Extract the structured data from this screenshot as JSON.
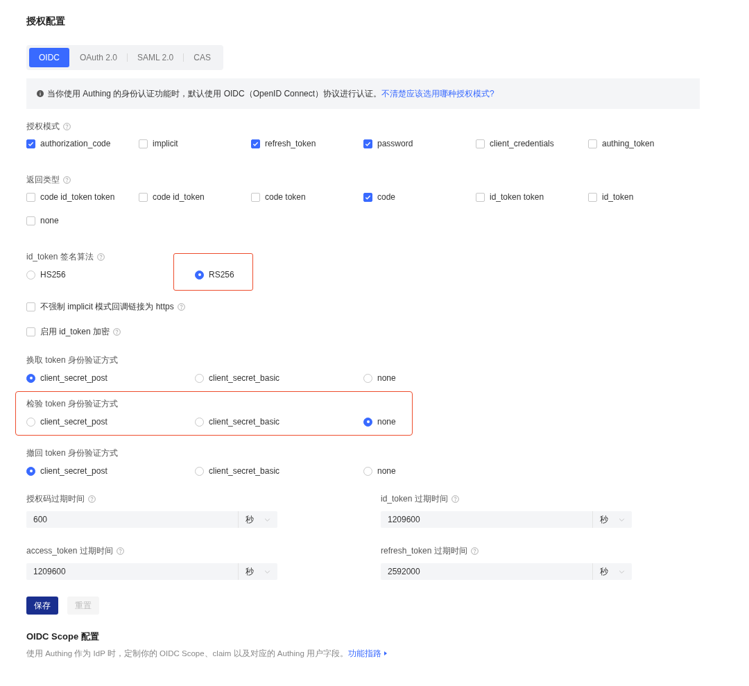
{
  "title": "授权配置",
  "tabs": [
    {
      "label": "OIDC",
      "selected": true
    },
    {
      "label": "OAuth 2.0",
      "selected": false
    },
    {
      "label": "SAML 2.0",
      "selected": false
    },
    {
      "label": "CAS",
      "selected": false
    }
  ],
  "notice": {
    "text": "当你使用 Authing 的身份认证功能时，默认使用 OIDC（OpenID Connect）协议进行认证。",
    "link": "不清楚应该选用哪种授权模式?"
  },
  "sections": [
    {
      "kind": "checkboxes",
      "label": "授权模式",
      "help": true,
      "highlighted": false,
      "options": [
        {
          "label": "authorization_code",
          "checked": true
        },
        {
          "label": "implicit",
          "checked": false
        },
        {
          "label": "refresh_token",
          "checked": true
        },
        {
          "label": "password",
          "checked": true
        },
        {
          "label": "client_credentials",
          "checked": false
        },
        {
          "label": "authing_token",
          "checked": false
        }
      ]
    },
    {
      "kind": "checkboxes",
      "label": "返回类型",
      "help": true,
      "highlighted": false,
      "options": [
        {
          "label": "code id_token token",
          "checked": false
        },
        {
          "label": "code id_token",
          "checked": false
        },
        {
          "label": "code token",
          "checked": false
        },
        {
          "label": "code",
          "checked": true
        },
        {
          "label": "id_token token",
          "checked": false
        },
        {
          "label": "id_token",
          "checked": false
        },
        {
          "label": "none",
          "checked": false
        }
      ]
    },
    {
      "kind": "radios",
      "label": "id_token 签名算法",
      "help": true,
      "highlighted": false,
      "options": [
        {
          "label": "HS256",
          "selected": false,
          "highlighted": false
        },
        {
          "label": "RS256",
          "selected": true,
          "highlighted": true
        }
      ]
    },
    {
      "kind": "toggle",
      "label": "不强制 implicit 模式回调链接为 https",
      "help": true,
      "checked": false
    },
    {
      "kind": "toggle",
      "label": "启用 id_token 加密",
      "help": true,
      "checked": false
    },
    {
      "kind": "radios",
      "label": "换取 token 身份验证方式",
      "help": false,
      "highlighted": false,
      "options": [
        {
          "label": "client_secret_post",
          "selected": true,
          "highlighted": false
        },
        {
          "label": "client_secret_basic",
          "selected": false,
          "highlighted": false
        },
        {
          "label": "none",
          "selected": false,
          "highlighted": false
        }
      ]
    },
    {
      "kind": "radios",
      "label": "检验 token 身份验证方式",
      "help": false,
      "highlighted": true,
      "options": [
        {
          "label": "client_secret_post",
          "selected": false,
          "highlighted": false
        },
        {
          "label": "client_secret_basic",
          "selected": false,
          "highlighted": false
        },
        {
          "label": "none",
          "selected": true,
          "highlighted": false
        }
      ]
    },
    {
      "kind": "radios",
      "label": "撤回 token 身份验证方式",
      "help": false,
      "highlighted": false,
      "options": [
        {
          "label": "client_secret_post",
          "selected": true,
          "highlighted": false
        },
        {
          "label": "client_secret_basic",
          "selected": false,
          "highlighted": false
        },
        {
          "label": "none",
          "selected": false,
          "highlighted": false
        }
      ]
    }
  ],
  "expiry_fields": [
    {
      "label": "授权码过期时间",
      "value": "600",
      "unit": "秒"
    },
    {
      "label": "id_token 过期时间",
      "value": "1209600",
      "unit": "秒"
    },
    {
      "label": "access_token 过期时间",
      "value": "1209600",
      "unit": "秒"
    },
    {
      "label": "refresh_token 过期时间",
      "value": "2592000",
      "unit": "秒"
    }
  ],
  "buttons": [
    {
      "label": "保存",
      "kind": "primary",
      "disabled": false
    },
    {
      "label": "重置",
      "kind": "secondary",
      "disabled": true
    }
  ],
  "scope": {
    "title": "OIDC Scope 配置",
    "text": "使用 Authing 作为 IdP 时，定制你的 OIDC Scope、claim 以及对应的 Authing 用户字段。",
    "link": "功能指路"
  }
}
